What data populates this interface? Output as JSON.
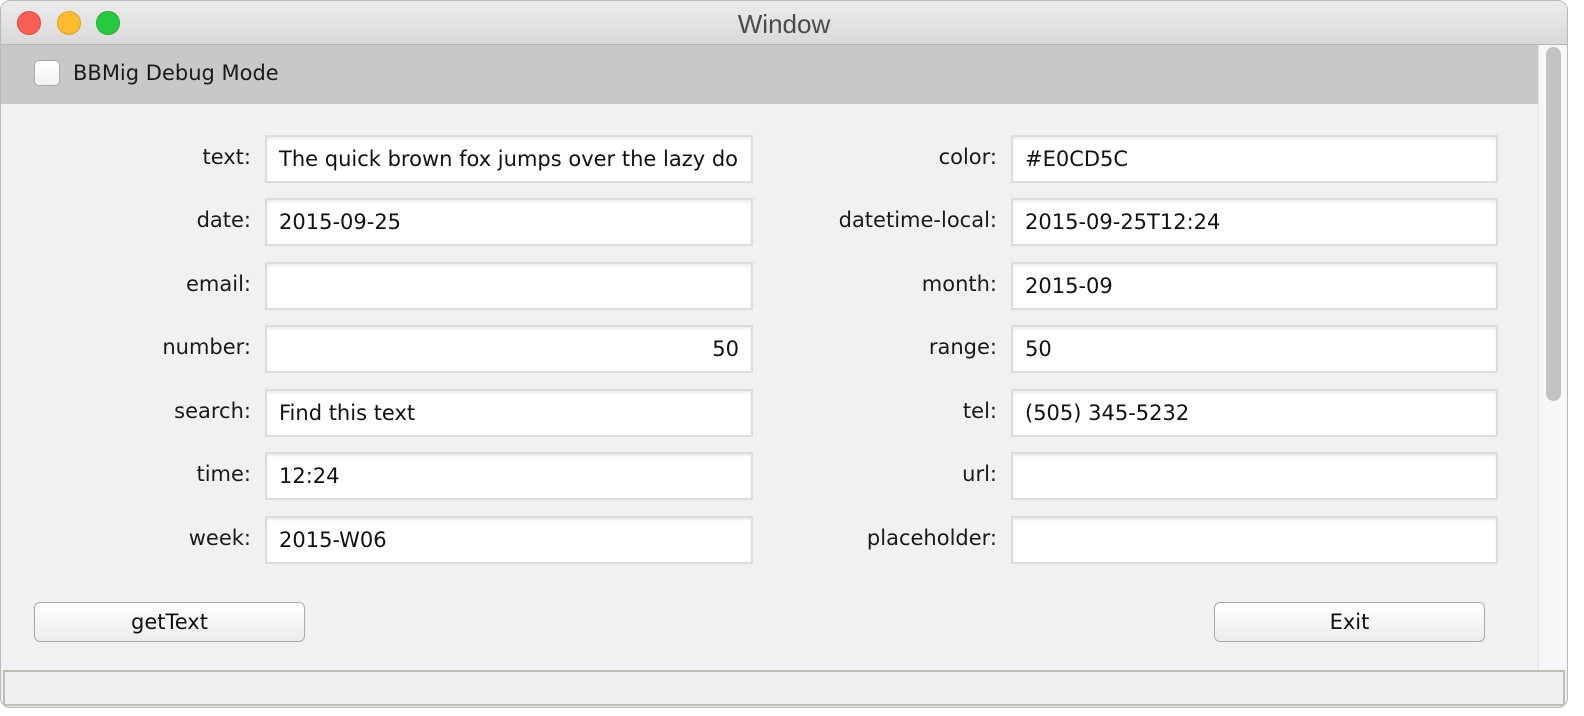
{
  "window": {
    "title": "Window"
  },
  "debug": {
    "label": "BBMig Debug Mode",
    "checked": false
  },
  "fields_left": [
    {
      "label": "text:",
      "value": "The quick brown fox jumps over the lazy do",
      "align": "left"
    },
    {
      "label": "date:",
      "value": "2015-09-25",
      "align": "left"
    },
    {
      "label": "email:",
      "value": "",
      "align": "left"
    },
    {
      "label": "number:",
      "value": "50",
      "align": "right"
    },
    {
      "label": "search:",
      "value": "Find this text",
      "align": "left"
    },
    {
      "label": "time:",
      "value": "12:24",
      "align": "left"
    },
    {
      "label": "week:",
      "value": "2015-W06",
      "align": "left"
    }
  ],
  "fields_right": [
    {
      "label": "color:",
      "value": "#E0CD5C",
      "align": "left"
    },
    {
      "label": "datetime-local:",
      "value": "2015-09-25T12:24",
      "align": "left"
    },
    {
      "label": "month:",
      "value": "2015-09",
      "align": "left"
    },
    {
      "label": "range:",
      "value": "50",
      "align": "left"
    },
    {
      "label": "tel:",
      "value": "(505) 345-5232",
      "align": "left"
    },
    {
      "label": "url:",
      "value": "",
      "align": "left"
    },
    {
      "label": "placeholder:",
      "value": "",
      "align": "left"
    }
  ],
  "buttons": {
    "get_text": "getText",
    "exit": "Exit"
  },
  "status": {
    "text": ""
  }
}
